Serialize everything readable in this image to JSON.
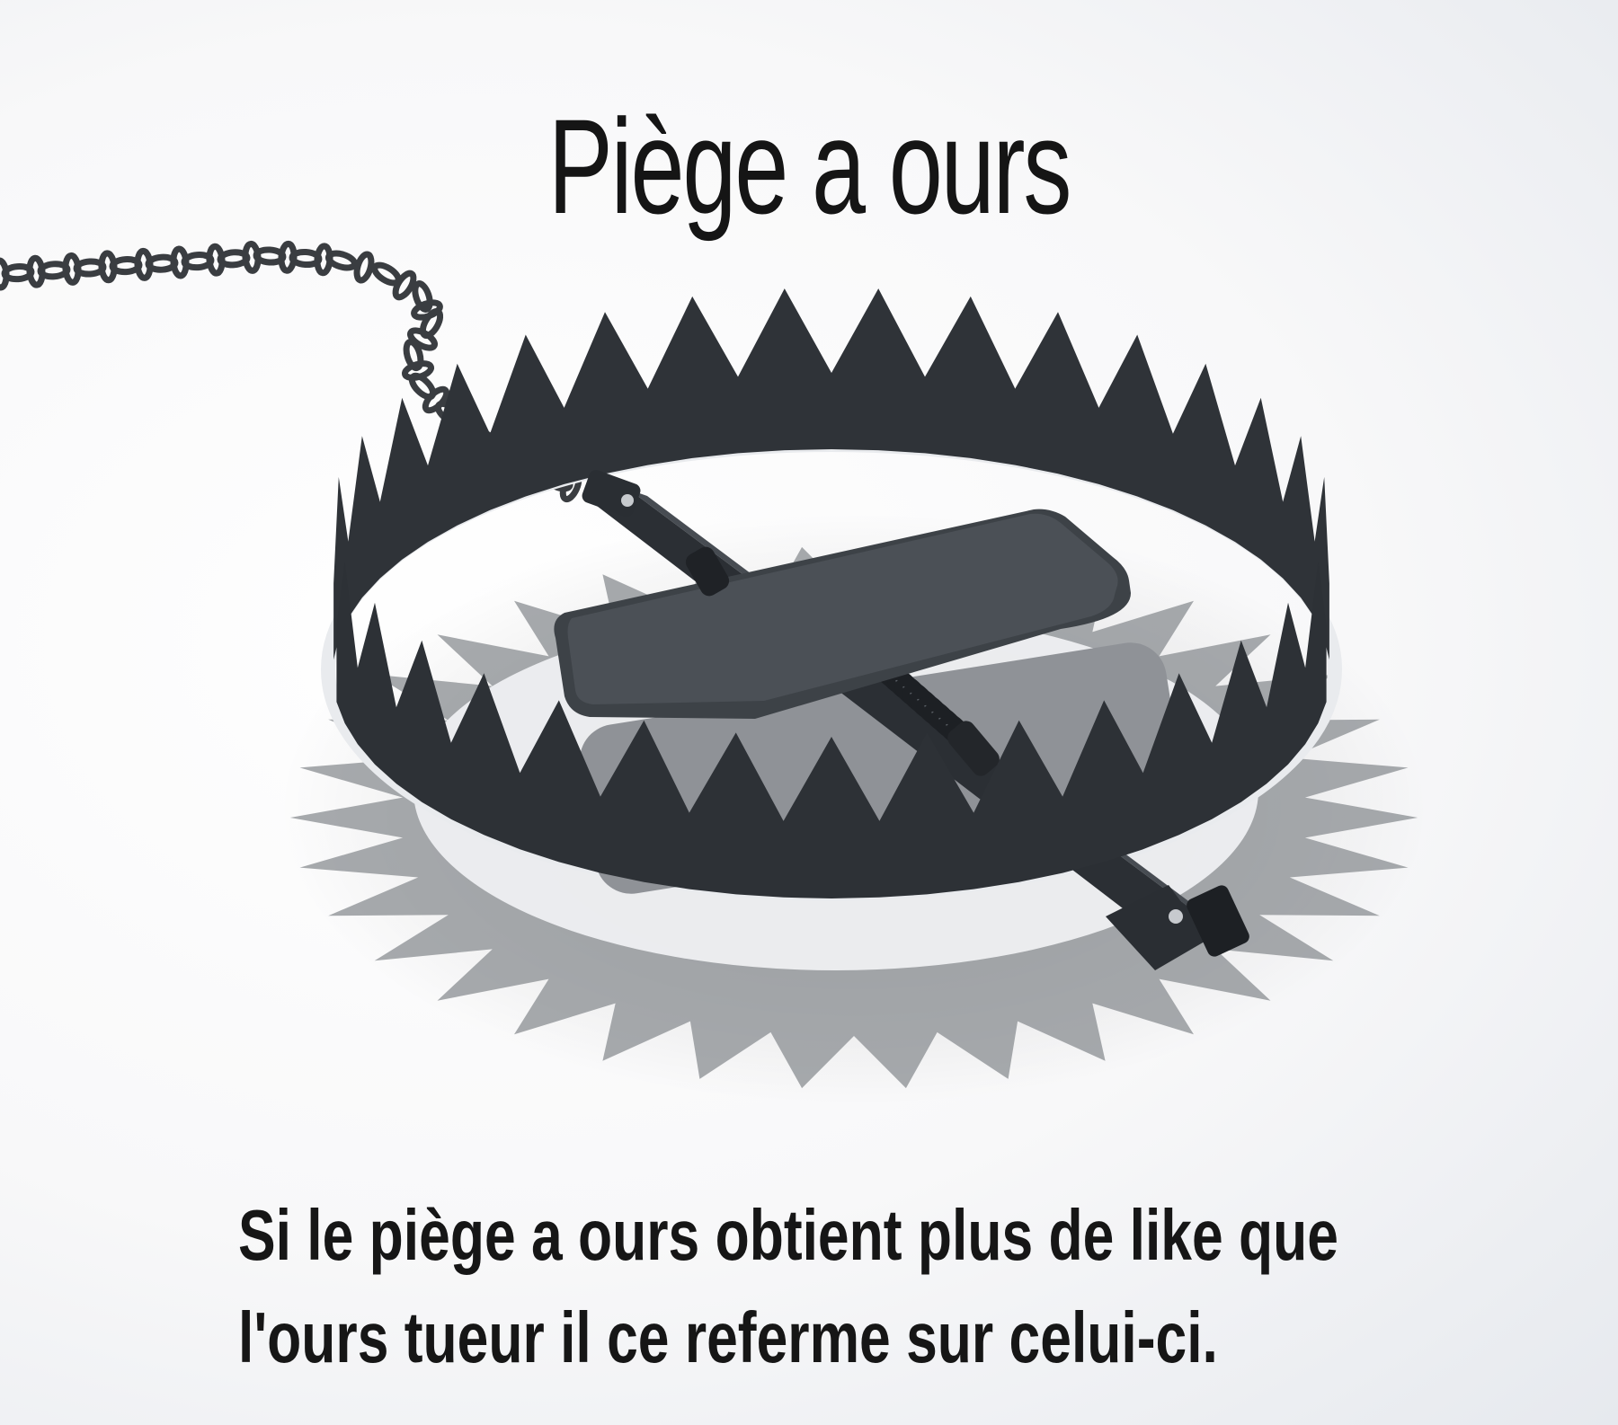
{
  "title": "Piège a ours",
  "caption": {
    "line1": "Si le piège a ours obtient plus de like que",
    "line2": "l'ours tueur il ce referme sur celui-ci."
  },
  "image": {
    "subject": "bear-trap",
    "colors": {
      "metal": "#2d3136",
      "shadow": "#8a8d92",
      "chain": "#3a3d41"
    }
  }
}
